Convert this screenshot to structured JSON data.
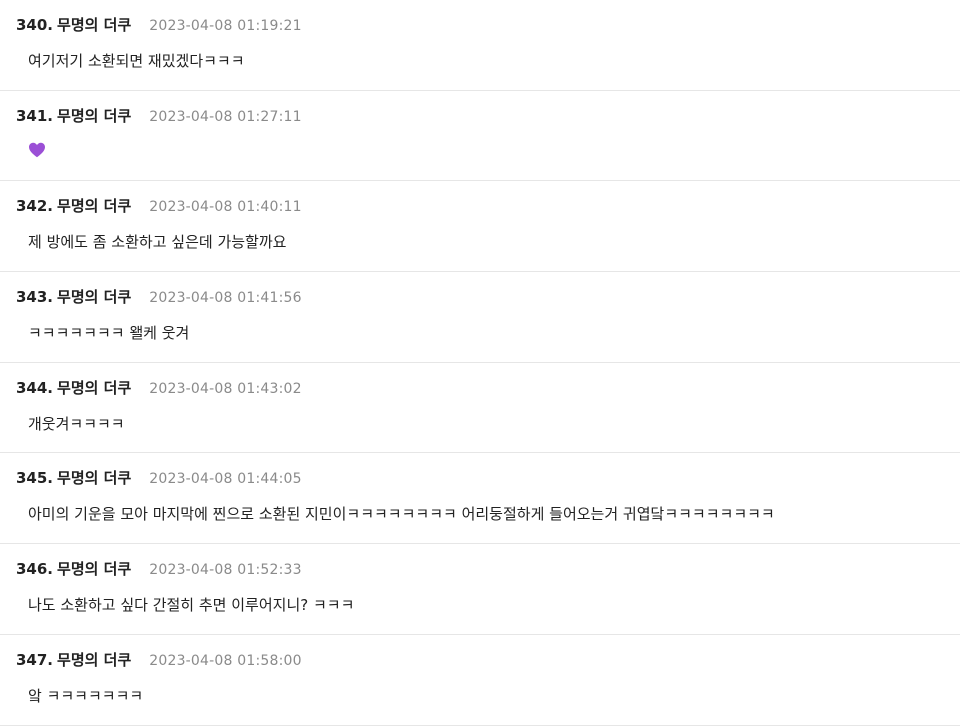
{
  "comments": [
    {
      "number": "340.",
      "author": "무명의 더쿠",
      "timestamp": "2023-04-08 01:19:21",
      "text": "여기저기 소환되면 재밌겠다ㅋㅋㅋ"
    },
    {
      "number": "341.",
      "author": "무명의 더쿠",
      "timestamp": "2023-04-08 01:27:11",
      "icon": "purple-heart-icon",
      "icon_color": "#9b4fd6"
    },
    {
      "number": "342.",
      "author": "무명의 더쿠",
      "timestamp": "2023-04-08 01:40:11",
      "text": "제 방에도 좀 소환하고 싶은데 가능할까요"
    },
    {
      "number": "343.",
      "author": "무명의 더쿠",
      "timestamp": "2023-04-08 01:41:56",
      "text": "ㅋㅋㅋㅋㅋㅋㅋ 왤케 웃겨"
    },
    {
      "number": "344.",
      "author": "무명의 더쿠",
      "timestamp": "2023-04-08 01:43:02",
      "text": "개웃겨ㅋㅋㅋㅋ"
    },
    {
      "number": "345.",
      "author": "무명의 더쿠",
      "timestamp": "2023-04-08 01:44:05",
      "text": "아미의 기운을 모아 마지막에 찐으로 소환된 지민이ㅋㅋㅋㅋㅋㅋㅋㅋ 어리둥절하게 들어오는거 귀엽닼ㅋㅋㅋㅋㅋㅋㅋㅋ"
    },
    {
      "number": "346.",
      "author": "무명의 더쿠",
      "timestamp": "2023-04-08 01:52:33",
      "text": "나도 소환하고 싶다 간절히 추면 이루어지니? ㅋㅋㅋ"
    },
    {
      "number": "347.",
      "author": "무명의 더쿠",
      "timestamp": "2023-04-08 01:58:00",
      "text": "앜 ㅋㅋㅋㅋㅋㅋㅋ"
    }
  ]
}
